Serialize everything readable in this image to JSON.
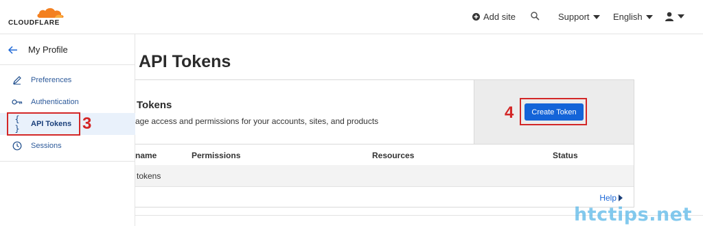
{
  "brand": {
    "name": "CLOUDFLARE",
    "logo_icon": "cloud-icon",
    "accent": "#f38020"
  },
  "topbar": {
    "add_site": "Add site",
    "support": "Support",
    "language": "English",
    "search_icon": "search-icon",
    "user_icon": "user-icon"
  },
  "sidebar": {
    "back_label": "My Profile",
    "items": [
      {
        "label": "Preferences",
        "icon": "pencil-icon"
      },
      {
        "label": "Authentication",
        "icon": "key-icon"
      },
      {
        "label": "API Tokens",
        "icon": "braces-icon",
        "active": true
      },
      {
        "label": "Sessions",
        "icon": "clock-icon"
      }
    ]
  },
  "annotations": {
    "step3": "3",
    "step4": "4",
    "color": "#d32626"
  },
  "main": {
    "page_title": "API Tokens",
    "card_title": "Tokens",
    "card_desc": "age access and permissions for your accounts, sites, and products",
    "create_button": "Create Token",
    "table": {
      "headers": [
        "name",
        "Permissions",
        "Resources",
        "Status"
      ],
      "empty_text": "tokens"
    },
    "help": "Help"
  },
  "watermark": "htctips.net"
}
